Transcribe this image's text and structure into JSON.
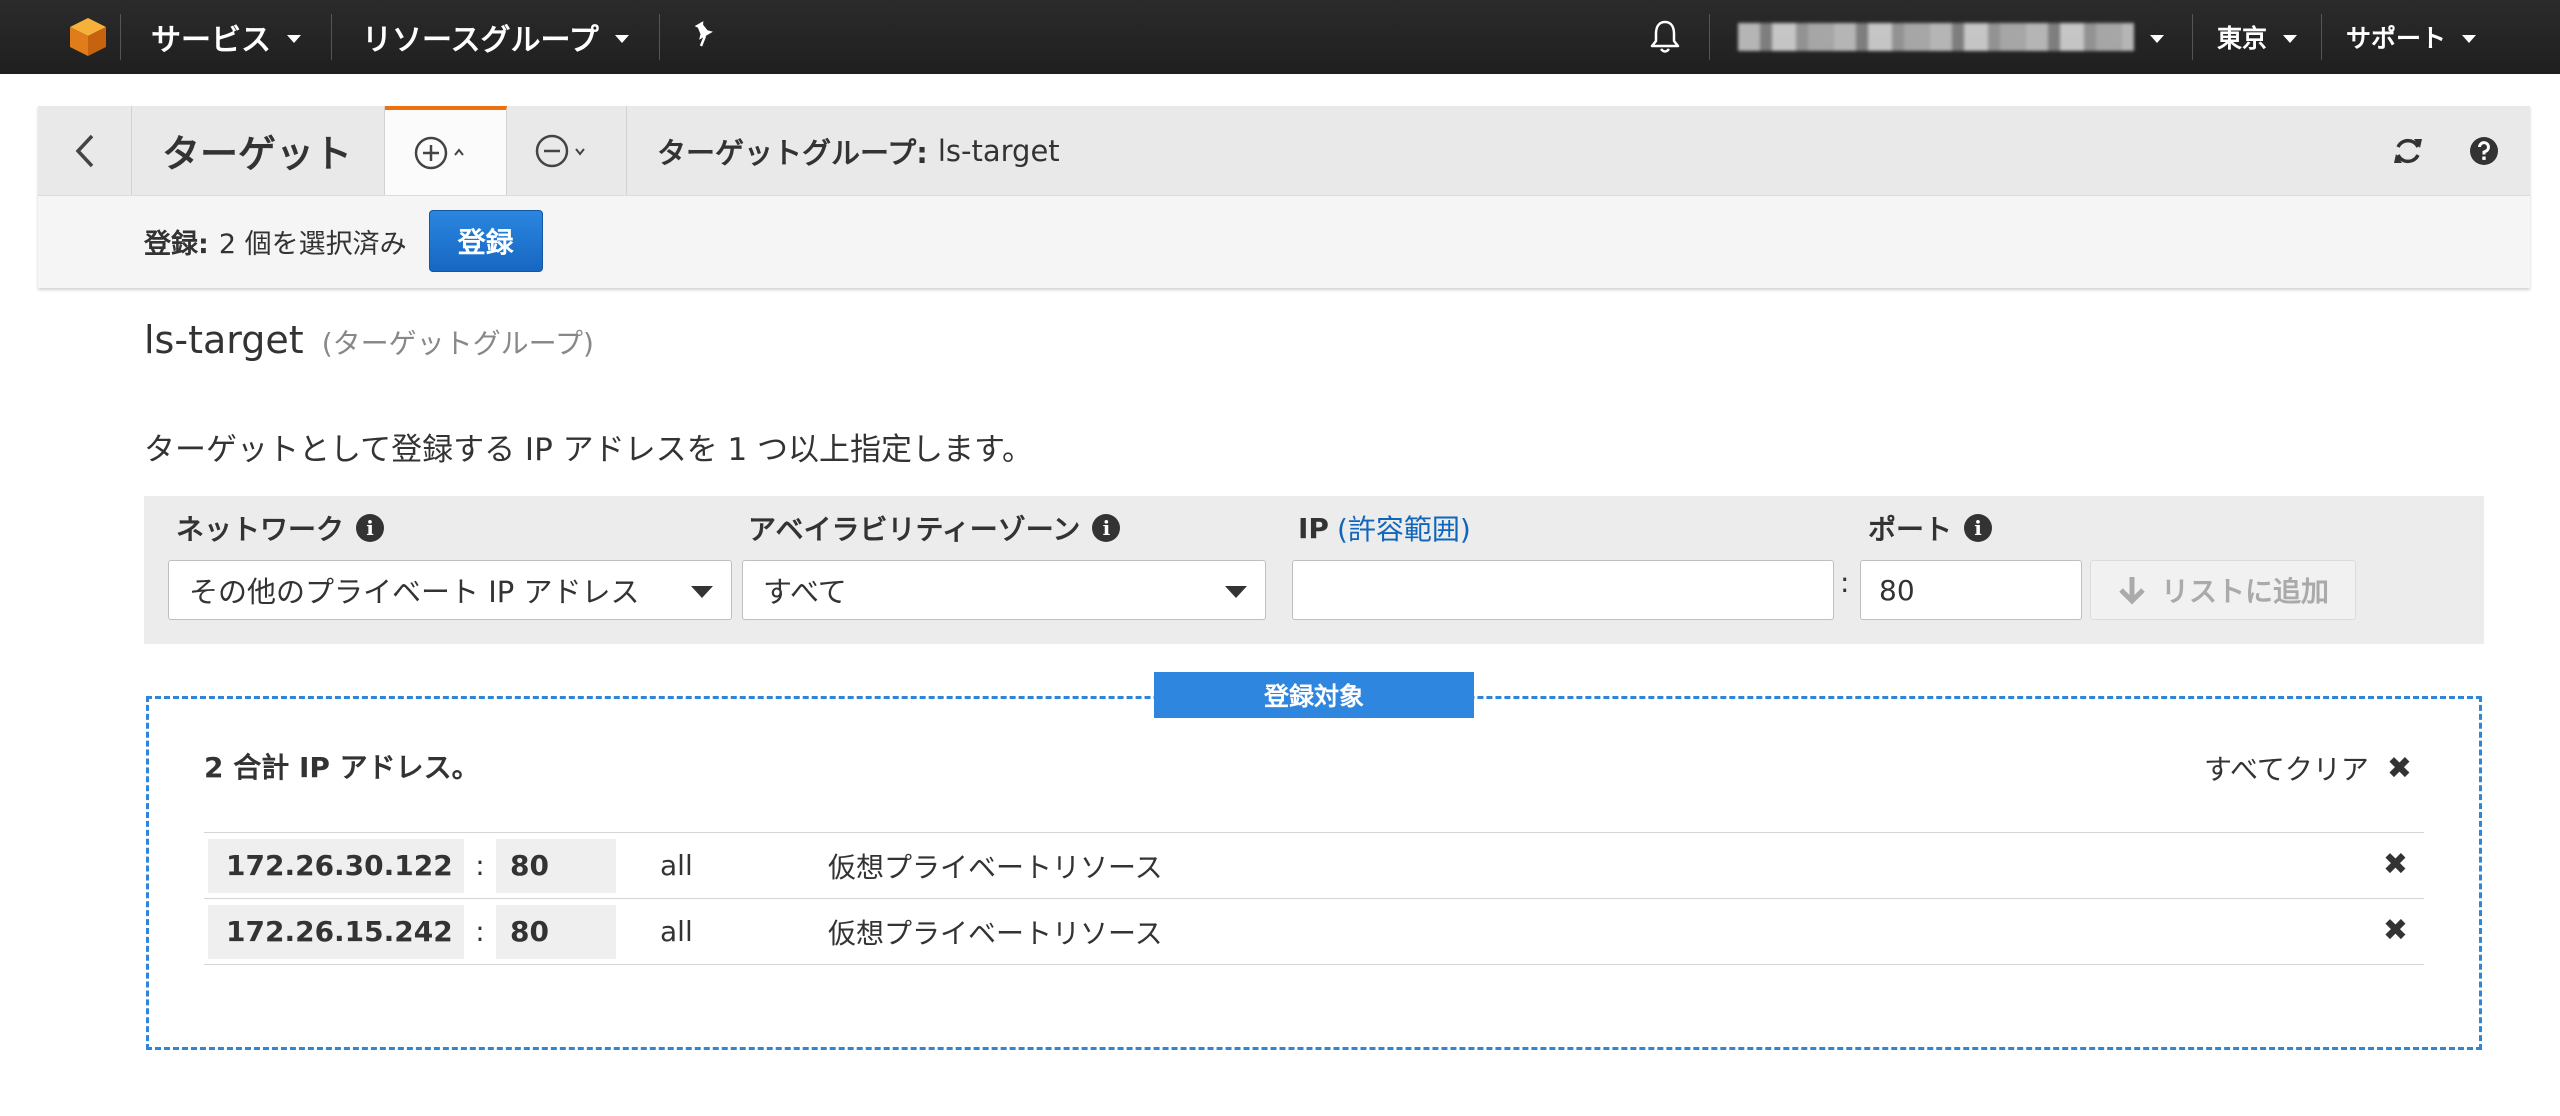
{
  "topnav": {
    "services_label": "サービス",
    "resource_groups_label": "リソースグループ",
    "region_label": "東京",
    "support_label": "サポート"
  },
  "header": {
    "title": "ターゲット",
    "group_prefix": "ターゲットグループ:",
    "group_name": "ls-target"
  },
  "register_bar": {
    "label": "登録:",
    "selected_text": "2 個を選択済み",
    "register_button": "登録"
  },
  "page": {
    "target_group_name": "ls-target",
    "target_group_type": "(ターゲットグループ)",
    "description": "ターゲットとして登録する IP アドレスを 1 つ以上指定します。"
  },
  "form": {
    "network_label": "ネットワーク",
    "network_value": "その他のプライベート IP アドレス",
    "az_label": "アベイラビリティーゾーン",
    "az_value": "すべて",
    "ip_label": "IP",
    "ip_link": "(許容範囲)",
    "ip_value": "",
    "port_label": "ポート",
    "port_value": "80",
    "add_button": "リストに追加"
  },
  "targets": {
    "section_label": "登録対象",
    "count_text": "2 合計 IP アドレス。",
    "clear_all": "すべてクリア",
    "rows": [
      {
        "ip": "172.26.30.122",
        "port": "80",
        "az": "all",
        "resource": "仮想プライベートリソース"
      },
      {
        "ip": "172.26.15.242",
        "port": "80",
        "az": "all",
        "resource": "仮想プライベートリソース"
      }
    ]
  },
  "colors": {
    "nav_bg": "#232f3e",
    "accent_orange": "#ec7211",
    "primary_blue": "#1a73c8",
    "targets_blue": "#2f86de"
  }
}
